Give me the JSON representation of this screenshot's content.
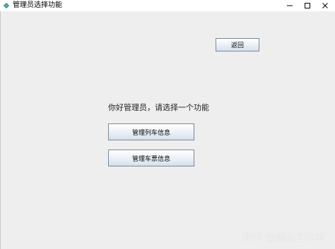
{
  "window": {
    "title": "管理员选择功能",
    "accent_color": "#2a7d7d"
  },
  "icons": {
    "app": "app-diamond-icon",
    "minimize": "minimize-icon",
    "maximize": "maximize-icon",
    "close": "close-icon"
  },
  "main": {
    "back_label": "返回",
    "greeting": "你好管理员，请选择一个功能",
    "manage_train_label": "管理列车信息",
    "manage_ticket_label": "管理车票信息"
  },
  "watermark": {
    "text": "知乎 @源点工作室"
  }
}
